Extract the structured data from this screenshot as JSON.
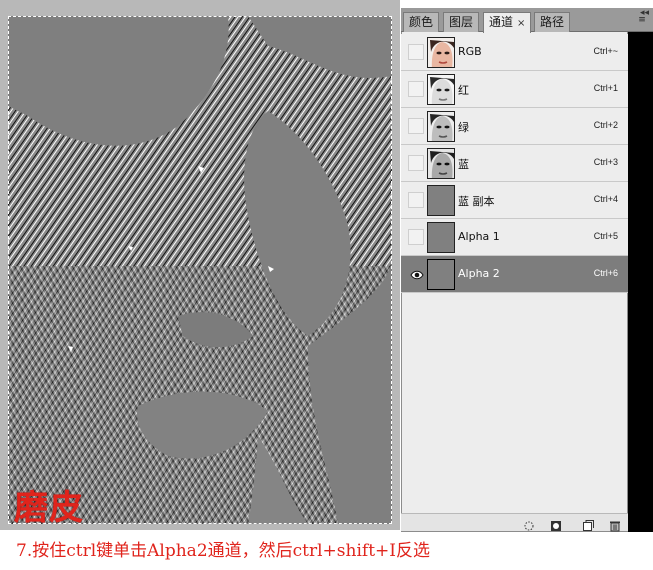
{
  "panel": {
    "tabs": [
      {
        "label": "颜色"
      },
      {
        "label": "图层"
      },
      {
        "label": "通道",
        "close": "×"
      },
      {
        "label": "路径"
      }
    ],
    "collapse": "◂◂",
    "menu": "≡",
    "channels": [
      {
        "name": "RGB",
        "shortcut": "Ctrl+~",
        "thumb": "face-color"
      },
      {
        "name": "红",
        "shortcut": "Ctrl+1",
        "thumb": "face-gray"
      },
      {
        "name": "绿",
        "shortcut": "Ctrl+2",
        "thumb": "face-gray"
      },
      {
        "name": "蓝",
        "shortcut": "Ctrl+3",
        "thumb": "face-gray"
      },
      {
        "name": "蓝 副本",
        "shortcut": "Ctrl+4",
        "thumb": "flat-gray"
      },
      {
        "name": "Alpha 1",
        "shortcut": "Ctrl+5",
        "thumb": "flat-gray"
      },
      {
        "name": "Alpha 2",
        "shortcut": "Ctrl+6",
        "thumb": "flat-gray",
        "selected": true
      }
    ],
    "bottom_icons": [
      "load-selection-icon",
      "save-selection-icon",
      "new-channel-icon",
      "delete-channel-icon"
    ]
  },
  "watermark": "磨皮",
  "caption": "7.按住ctrl键单击Alpha2通道，然后ctrl+shift+I反选",
  "colors": {
    "caption": "#e0241c",
    "selected_row": "#7d7d7d",
    "canvas_gray": "#7f7f7f"
  }
}
